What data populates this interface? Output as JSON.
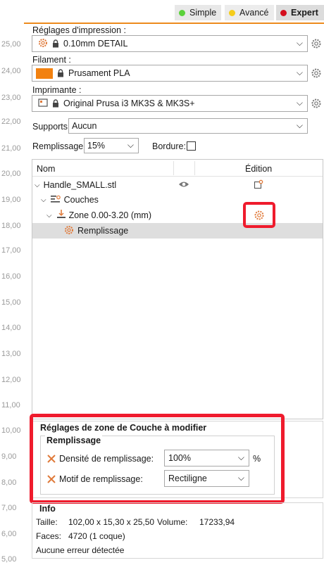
{
  "ruler": [
    "25,00",
    "24,00",
    "23,00",
    "22,00",
    "21,00",
    "20,00",
    "19,00",
    "18,00",
    "17,00",
    "16,00",
    "15,00",
    "14,00",
    "13,00",
    "12,00",
    "11,00",
    "10,00",
    "9,00",
    "8,00",
    "7,00",
    "6,00",
    "5,00"
  ],
  "modes": {
    "simple": {
      "label": "Simple",
      "color": "#5ad13a"
    },
    "avance": {
      "label": "Avancé",
      "color": "#f5cc1a"
    },
    "expert": {
      "label": "Expert",
      "color": "#d40f1e"
    }
  },
  "print_settings": {
    "label": "Réglages d'impression :",
    "value": "0.10mm DETAIL"
  },
  "filament": {
    "label": "Filament :",
    "value": "Prusament PLA",
    "swatch_color": "#f2810f"
  },
  "printer": {
    "label": "Imprimante :",
    "value": "Original Prusa i3 MK3S & MK3S+"
  },
  "supports": {
    "label": "Supports:",
    "value": "Aucun"
  },
  "infill": {
    "label": "Remplissage:",
    "value": "15%"
  },
  "brim": {
    "label": "Bordure:",
    "checked": false
  },
  "tree": {
    "col_name": "Nom",
    "col_edit": "Édition",
    "object": "Handle_SMALL.stl",
    "layers": "Couches",
    "zone": "Zone 0.00-3.20 (mm)",
    "infill_item": "Remplissage"
  },
  "zone_settings": {
    "title": "Réglages de zone de Couche à modifier",
    "group": "Remplissage",
    "density_label": "Densité de remplissage:",
    "density_value": "100%",
    "density_unit": "%",
    "pattern_label": "Motif de remplissage:",
    "pattern_value": "Rectiligne"
  },
  "info": {
    "title": "Info",
    "size_label": "Taille:",
    "size_value": "102,00 x 15,30 x 25,50",
    "volume_label": "Volume:",
    "volume_value": "17233,94",
    "faces_label": "Faces:",
    "faces_value": "4720 (1 coque)",
    "errors": "Aucune erreur détectée"
  },
  "colors": {
    "accent": "#ec8a1d",
    "highlight": "#ef1b2d"
  }
}
